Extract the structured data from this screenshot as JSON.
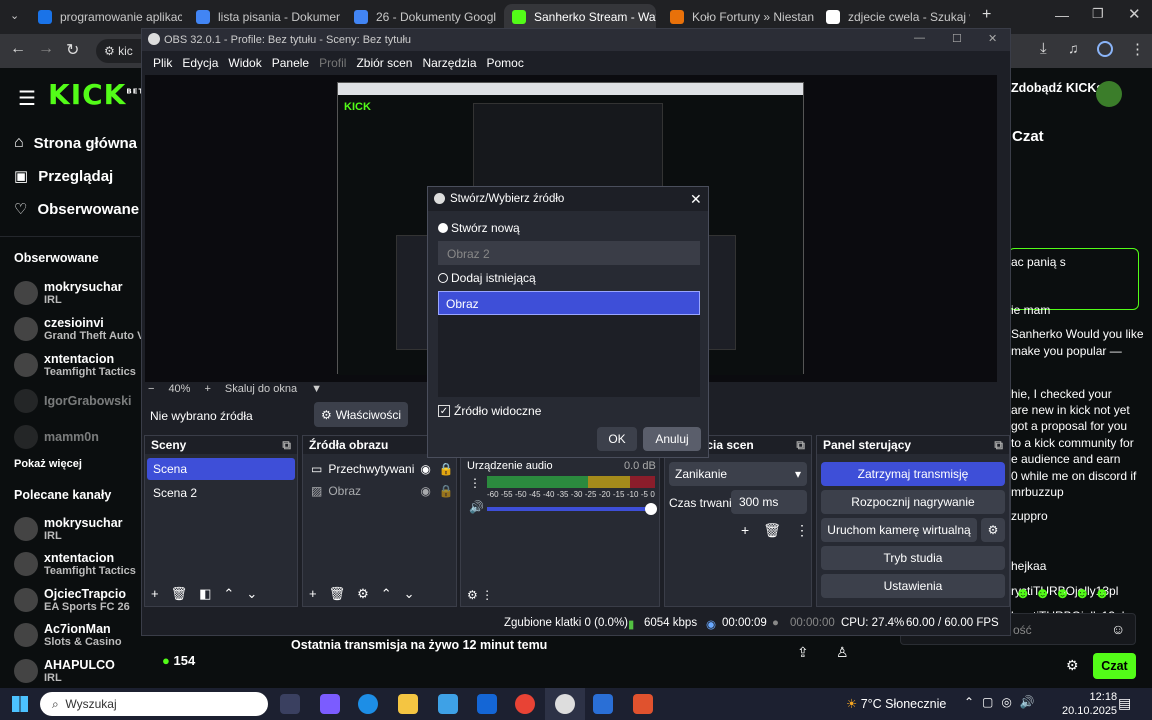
{
  "browser": {
    "tabs": [
      {
        "label": "programowanie aplikac",
        "color": "#1a73e8",
        "active": false
      },
      {
        "label": "lista pisania - Dokumen",
        "color": "#4285f4",
        "active": false
      },
      {
        "label": "26 - Dokumenty Googl",
        "color": "#4285f4",
        "active": false
      },
      {
        "label": "Sanherko Stream - Wat",
        "color": "#53fc18",
        "active": true
      },
      {
        "label": "Koło Fortuny » Niestand",
        "color": "#e8710a",
        "active": false
      },
      {
        "label": "zdjecie cwela - Szukaj w",
        "color": "#ffffff",
        "active": false
      }
    ],
    "address_partial": "kic"
  },
  "kick": {
    "logo": "KICK",
    "logo_sup": "BETA",
    "nav": [
      "Strona główna",
      "Przeglądaj",
      "Obserwowane"
    ],
    "followed_heading": "Obserwowane",
    "followed": [
      {
        "name": "mokrysuchar",
        "game": "IRL",
        "dim": false
      },
      {
        "name": "czesioinvi",
        "game": "Grand Theft Auto V (G",
        "dim": false
      },
      {
        "name": "xntentacion",
        "game": "Teamfight Tactics",
        "dim": false
      },
      {
        "name": "IgorGrabowski",
        "game": "",
        "dim": true
      },
      {
        "name": "mamm0n",
        "game": "",
        "dim": true
      }
    ],
    "show_more": "Pokaż więcej",
    "recommended_heading": "Polecane kanały",
    "recommended": [
      {
        "name": "mokrysuchar",
        "game": "IRL"
      },
      {
        "name": "xntentacion",
        "game": "Teamfight Tactics"
      },
      {
        "name": "OjciecTrapcio",
        "game": "EA Sports FC 26"
      },
      {
        "name": "Ac7ionMan",
        "game": "Slots & Casino"
      },
      {
        "name": "AHAPULCO",
        "game": "IRL"
      }
    ],
    "viewer_count": "154",
    "last_stream": "Ostatnia transmisja na żywo 12 minut temu",
    "get_kicks": "Zdobądź KICKs",
    "chat_heading": "Czat",
    "chat_lines": [
      "ac panią s",
      "ie mam",
      "Sanherko Would you like",
      "make you popular —",
      "hie, I checked your",
      "are new in kick not yet",
      "got a proposal for you",
      "to a kick community for",
      "e audience and earn",
      "0 while me on discord if",
      "mrbuzzup",
      "zuppro",
      "hejkaa",
      "rystiTURBOjelly13pl",
      "krystiTURBOjelly13pl"
    ],
    "chat_placeholder": "ość",
    "chat_button": "Czat"
  },
  "obs": {
    "title": "OBS 32.0.1 - Profile: Bez tytułu - Sceny: Bez tytułu",
    "menu": [
      {
        "label": "Plik",
        "disabled": false
      },
      {
        "label": "Edycja",
        "disabled": false
      },
      {
        "label": "Widok",
        "disabled": false
      },
      {
        "label": "Panele",
        "disabled": false
      },
      {
        "label": "Profil",
        "disabled": true
      },
      {
        "label": "Zbiór scen",
        "disabled": false
      },
      {
        "label": "Narzędzia",
        "disabled": false
      },
      {
        "label": "Pomoc",
        "disabled": false
      }
    ],
    "zoom": "40%",
    "scale_label": "Skaluj do okna",
    "no_source": "Nie wybrano źródła",
    "properties": "Właściwości",
    "scenes_title": "Sceny",
    "scenes": [
      "Scena",
      "Scena 2"
    ],
    "sources_title": "Źródła obrazu",
    "sources": [
      "Przechwytywanie",
      "Obraz"
    ],
    "audio_device": "Urządzenie audio",
    "audio_db": "0.0 dB",
    "meter_ticks": [
      "-60",
      "-55",
      "-50",
      "-45",
      "-40",
      "-35",
      "-30",
      "-25",
      "-20",
      "-15",
      "-10",
      "-5",
      "0"
    ],
    "transitions_title": "Przejścia scen",
    "transition_value": "Zanikanie",
    "duration_label": "Czas trwania",
    "duration_value": "300 ms",
    "controls_title": "Panel sterujący",
    "controls": {
      "stop_stream": "Zatrzymaj transmisję",
      "start_record": "Rozpocznij nagrywanie",
      "virtual_cam": "Uruchom kamerę wirtualną",
      "studio": "Tryb studia",
      "settings": "Ustawienia"
    },
    "status": {
      "dropped": "Zgubione klatki 0 (0.0%)",
      "bitrate": "6054 kbps",
      "stream_time": "00:00:09",
      "rec_time": "00:00:00",
      "cpu": "CPU: 27.4%",
      "fps": "60.00 / 60.00 FPS"
    }
  },
  "dialog": {
    "title": "Stwórz/Wybierz źródło",
    "create_new": "Stwórz nową",
    "new_name_value": "Obraz 2",
    "add_existing": "Dodaj istniejącą",
    "existing_items": [
      "Obraz"
    ],
    "visible_label": "Źródło widoczne",
    "ok": "OK",
    "cancel": "Anuluj"
  },
  "taskbar": {
    "search": "Wyszukaj",
    "weather": "7°C  Słonecznie",
    "time": "12:18",
    "date": "20.10.2025"
  }
}
